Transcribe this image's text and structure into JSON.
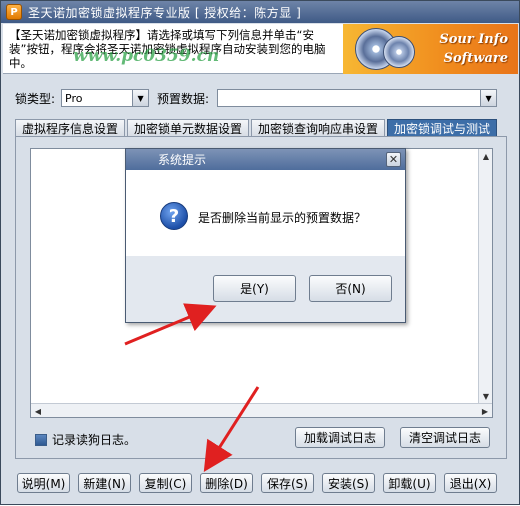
{
  "window": {
    "title": "圣天诺加密锁虚拟程序专业版 [ 授权给：陈方显 ]"
  },
  "banner": {
    "text": "【圣天诺加密锁虚拟程序】请选择或填写下列信息并单击“安装”按钮，程序会将圣天诺加密锁虚拟程序自动安装到您的电脑中。",
    "watermark": "www.pc0359.cn",
    "logo_line1": "Sour Info",
    "logo_line2": "Software"
  },
  "form": {
    "lock_type_label": "锁类型:",
    "lock_type_value": "Pro",
    "preset_label": "预置数据:",
    "preset_value": ""
  },
  "tabs": [
    {
      "label": "虚拟程序信息设置"
    },
    {
      "label": "加密锁单元数据设置"
    },
    {
      "label": "加密锁查询响应串设置"
    },
    {
      "label": "加密锁调试与测试",
      "active": true
    }
  ],
  "panel": {
    "log_checkbox_label": "记录读狗日志。",
    "load_log_button": "加载调试日志",
    "clear_log_button": "清空调试日志"
  },
  "buttons": {
    "help": "说明(M)",
    "new": "新建(N)",
    "copy": "复制(C)",
    "delete": "删除(D)",
    "save": "保存(S)",
    "install": "安装(S)",
    "uninstall": "卸载(U)",
    "exit": "退出(X)"
  },
  "dialog": {
    "title": "系统提示",
    "message": "是否删除当前显示的预置数据？",
    "yes": "是(Y)",
    "no": "否(N)",
    "close_symbol": "✕",
    "icon_glyph": "?"
  },
  "colors": {
    "title_bar": "#4f6d9c",
    "active_tab": "#3d6ea8",
    "annotation_arrow": "#e02020"
  }
}
